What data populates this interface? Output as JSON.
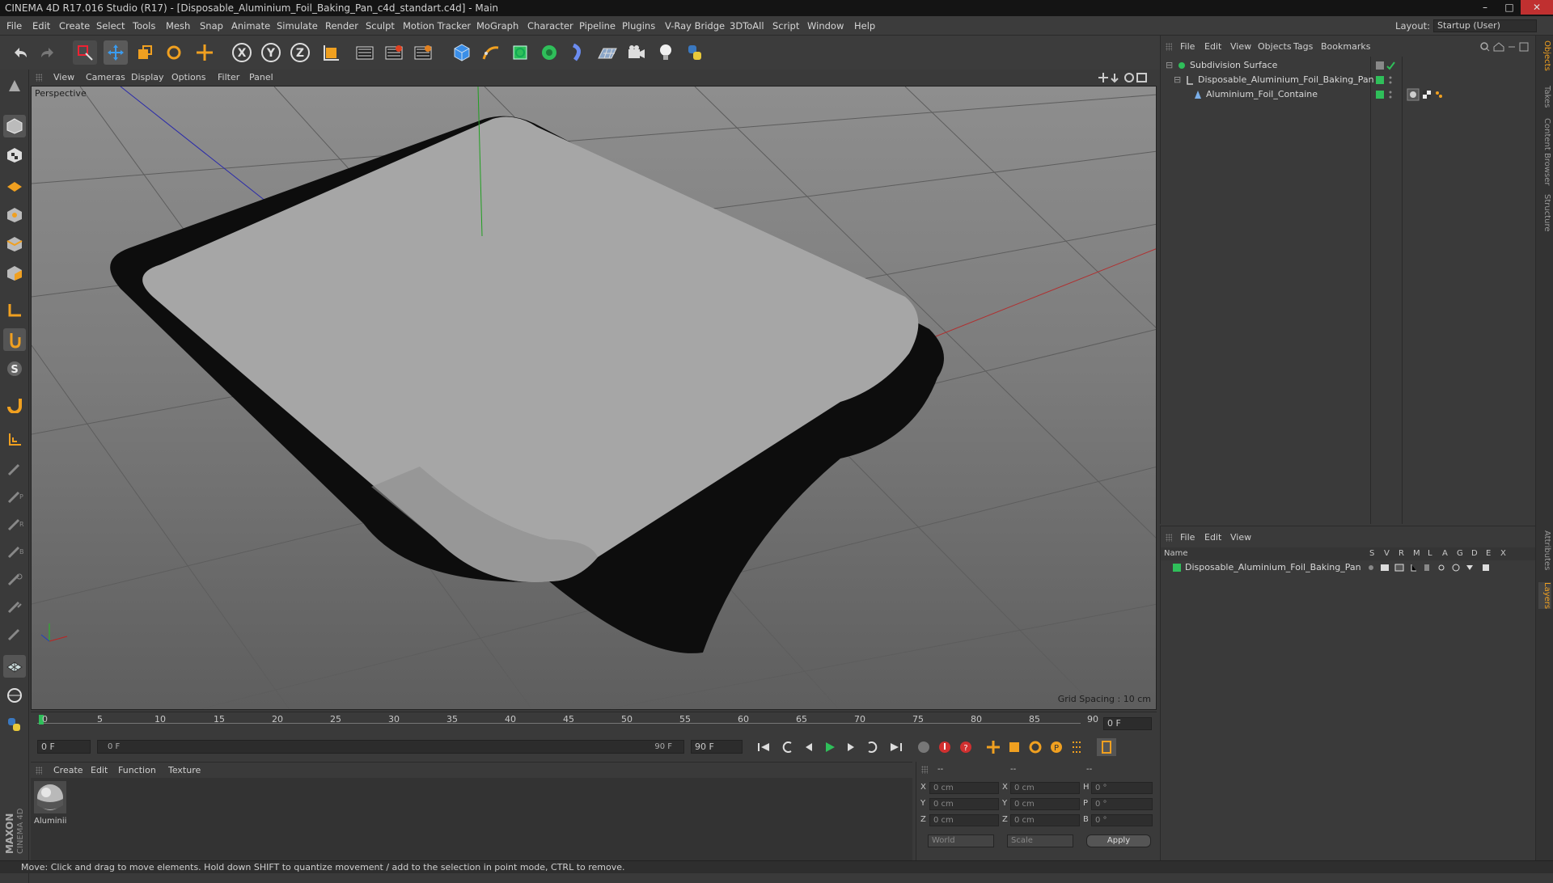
{
  "window": {
    "title": "CINEMA 4D R17.016 Studio (R17) - [Disposable_Aluminium_Foil_Baking_Pan_c4d_standart.c4d] - Main"
  },
  "menubar": {
    "items": [
      "File",
      "Edit",
      "Create",
      "Select",
      "Tools",
      "Mesh",
      "Snap",
      "Animate",
      "Simulate",
      "Render",
      "Sculpt",
      "Motion Tracker",
      "MoGraph",
      "Character",
      "Pipeline",
      "Plugins",
      "V-Ray Bridge",
      "3DToAll",
      "Script",
      "Window",
      "Help"
    ]
  },
  "layout": {
    "label": "Layout:",
    "value": "Startup (User)"
  },
  "viewport": {
    "menu": [
      "View",
      "Cameras",
      "Display",
      "Options",
      "Filter",
      "Panel"
    ],
    "label": "Perspective",
    "grid_spacing": "Grid Spacing : 10 cm"
  },
  "timeline": {
    "ticks": [
      "0",
      "5",
      "10",
      "15",
      "20",
      "25",
      "30",
      "35",
      "40",
      "45",
      "50",
      "55",
      "60",
      "65",
      "70",
      "75",
      "80",
      "85",
      "90"
    ],
    "current_frame": "0 F"
  },
  "transport": {
    "start_field": "0 F",
    "range_start": "0 F",
    "range_end": "90 F",
    "end_field": "90 F"
  },
  "material_panel": {
    "menu": [
      "Create",
      "Edit",
      "Function",
      "Texture"
    ],
    "materials": [
      {
        "name": "Aluminii"
      }
    ]
  },
  "coordinates": {
    "headers": [
      "--",
      "--",
      "--"
    ],
    "rows": [
      {
        "axis": "X",
        "pos": "0 cm",
        "axis2": "X",
        "size": "0 cm",
        "rot_label": "H",
        "rot": "0 °"
      },
      {
        "axis": "Y",
        "pos": "0 cm",
        "axis2": "Y",
        "size": "0 cm",
        "rot_label": "P",
        "rot": "0 °"
      },
      {
        "axis": "Z",
        "pos": "0 cm",
        "axis2": "Z",
        "size": "0 cm",
        "rot_label": "B",
        "rot": "0 °"
      }
    ],
    "mode": "World",
    "scale": "Scale",
    "apply": "Apply"
  },
  "object_manager": {
    "menu": [
      "File",
      "Edit",
      "View",
      "Objects",
      "Tags",
      "Bookmarks"
    ],
    "objects": [
      {
        "name": "Subdivision Surface",
        "level": 0
      },
      {
        "name": "Disposable_Aluminium_Foil_Baking_Pan",
        "level": 1
      },
      {
        "name": "Aluminium_Foil_Containe",
        "level": 2
      }
    ]
  },
  "layer_manager": {
    "menu": [
      "File",
      "Edit",
      "View"
    ],
    "columns": [
      "Name",
      "S",
      "V",
      "R",
      "M",
      "L",
      "A",
      "G",
      "D",
      "E",
      "X"
    ],
    "layers": [
      {
        "name": "Disposable_Aluminium_Foil_Baking_Pan"
      }
    ]
  },
  "right_tabs": [
    "Objects",
    "Takes",
    "Content Browser",
    "Structure",
    "Attributes",
    "Layers"
  ],
  "status": {
    "text": "Move: Click and drag to move elements. Hold down SHIFT to quantize movement / add to the selection in point mode, CTRL to remove."
  },
  "brand": {
    "maxon": "MAXON",
    "product": "CINEMA 4D"
  },
  "colors": {
    "accent_green": "#2fbf5a",
    "accent_orange": "#f0a020",
    "accent_blue": "#3a8ee8"
  }
}
